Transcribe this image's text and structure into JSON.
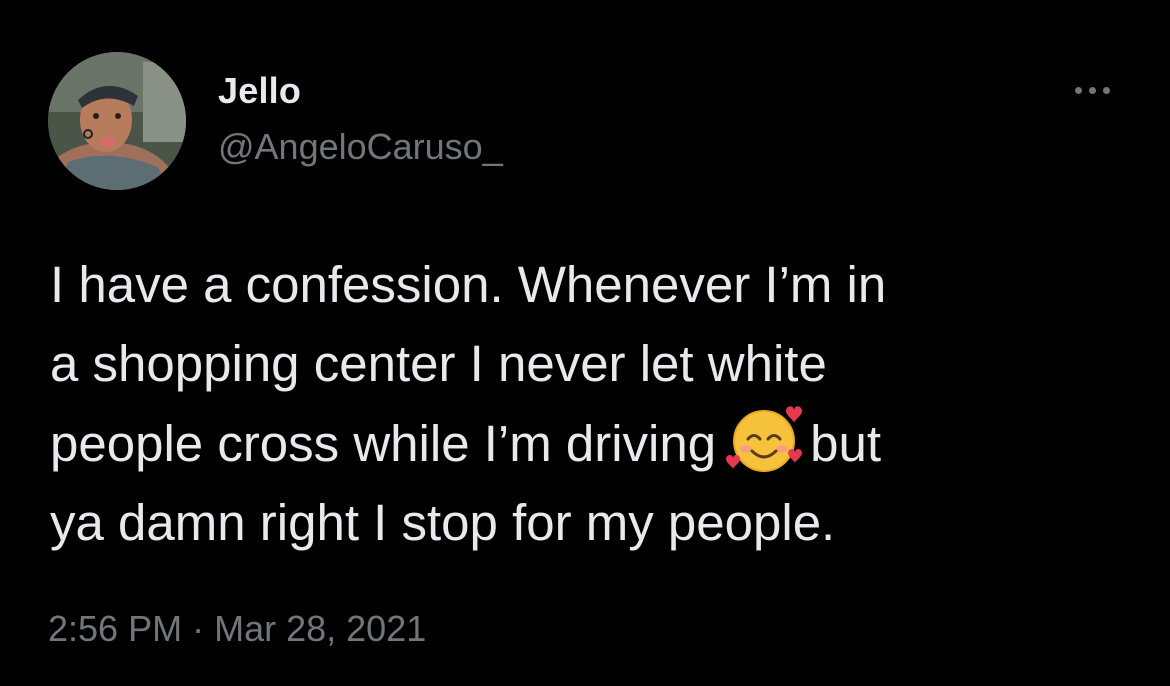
{
  "user": {
    "display_name": "Jello",
    "handle": "@AngeloCaruso_",
    "avatar_icon": "profile-photo"
  },
  "menu": {
    "icon": "more-horizontal-icon"
  },
  "tweet": {
    "line1": "I have a confession. Whenever I’m in",
    "line2": "a shopping center I never let white",
    "line3a": "people cross while I’m driving",
    "line3b": "but",
    "line4": "ya damn right I stop for my people.",
    "emoji": "smiling-face-with-hearts-emoji"
  },
  "meta": {
    "time": "2:56 PM",
    "separator": "·",
    "date": "Mar 28, 2021"
  },
  "colors": {
    "background": "#000000",
    "primary_text": "#e7e9ea",
    "secondary_text": "#71767b"
  }
}
